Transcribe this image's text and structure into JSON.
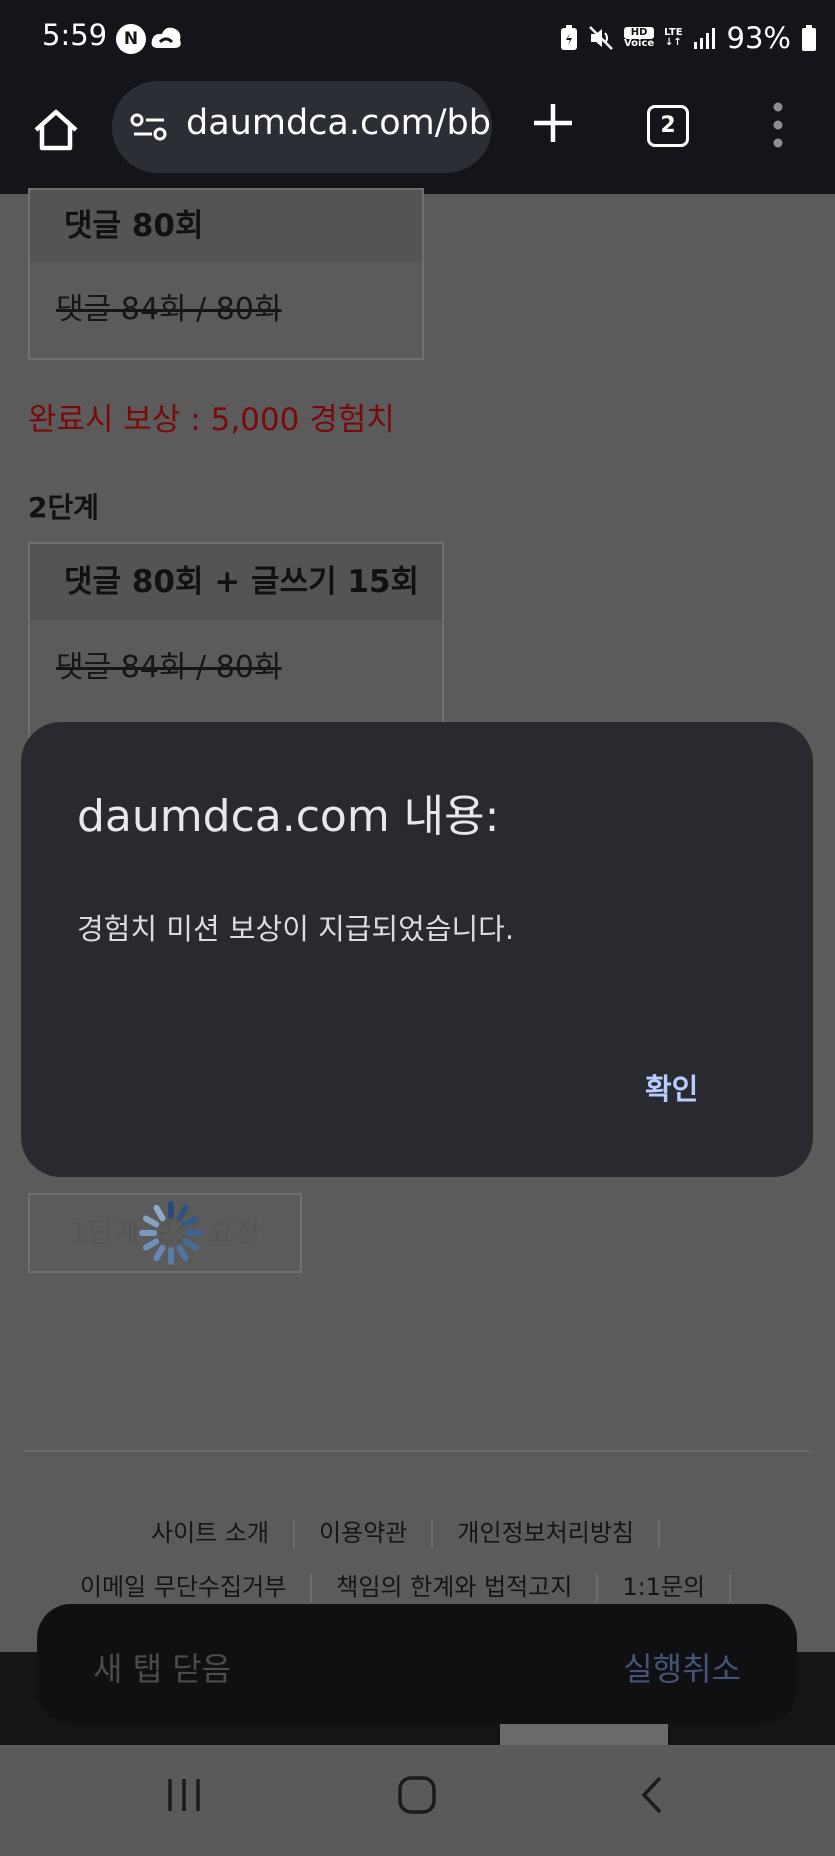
{
  "status_bar": {
    "time": "5:59",
    "notification_icons": [
      "n-badge-icon",
      "cloud-icon"
    ],
    "hd_label": "HD",
    "voice_label": "Voice",
    "lte_label": "LTE",
    "battery_percent": "93%"
  },
  "browser": {
    "url": "daumdca.com/bbs",
    "tab_count": "2"
  },
  "page": {
    "step1_box": {
      "heading": "댓글 80회",
      "progress": "댓글 84회 / 80회"
    },
    "reward_text": "완료시 보상 : 5,000 경험치",
    "step2_label": "2단계",
    "step2_box": {
      "heading": "댓글 80회 + 글쓰기 15회",
      "progress": "댓글 84회 / 80회"
    },
    "request_button_label": "1단계 보상 요청",
    "footer": {
      "row1": [
        "사이트 소개",
        "이용약관",
        "개인정보처리방침"
      ],
      "row2": [
        "이메일 무단수집거부",
        "책임의 한계와 법적고지",
        "1:1문의"
      ]
    }
  },
  "dialog": {
    "title": "daumdca.com 내용:",
    "message": "경험치 미션 보상이 지급되었습니다.",
    "ok_label": "확인"
  },
  "snackbar": {
    "message": "새 탭 닫음",
    "action_label": "실행취소"
  },
  "colors": {
    "dialog_bg": "#292a2f",
    "dialog_button": "#b9ccff",
    "reward_red": "#7a0a0a",
    "toolbar_bg": "#13151a"
  }
}
